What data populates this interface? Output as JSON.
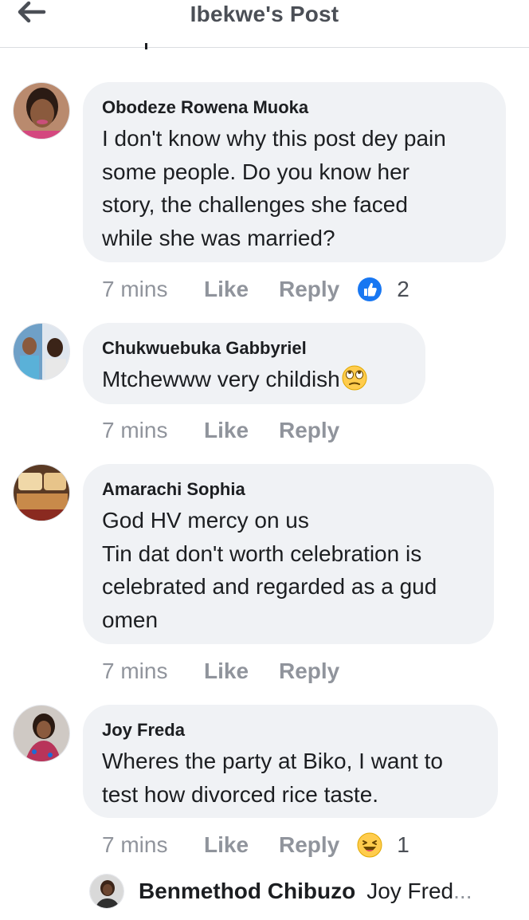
{
  "header": {
    "title": "Ibekwe's Post"
  },
  "comments": [
    {
      "author": "Obodeze Rowena Muoka",
      "lines": [
        "I don't know why this post dey pain",
        "some people. Do you know her",
        "story, the challenges she faced",
        "while she was married?"
      ],
      "time": "7 mins",
      "like_label": "Like",
      "reply_label": "Reply",
      "reaction": {
        "icon": "like-reaction-icon",
        "count": "2"
      }
    },
    {
      "author": "Chukwuebuka Gabbyriel",
      "lines": [
        "Mtchewww very childish"
      ],
      "inline_emoji": "eye-roll-emoji",
      "time": "7 mins",
      "like_label": "Like",
      "reply_label": "Reply"
    },
    {
      "author": "Amarachi Sophia",
      "lines": [
        "God HV mercy on us",
        "Tin dat don't worth celebration is",
        "celebrated and regarded as a gud",
        "omen"
      ],
      "time": "7 mins",
      "like_label": "Like",
      "reply_label": "Reply"
    },
    {
      "author": "Joy Freda",
      "lines": [
        "Wheres the party at Biko, I want to",
        "test how divorced rice taste."
      ],
      "time": "7 mins",
      "like_label": "Like",
      "reply_label": "Reply",
      "reaction": {
        "icon": "haha-reaction-icon",
        "count": "1"
      }
    }
  ],
  "reply_preview": {
    "author": "Benmethod Chibuzo",
    "text": "Joy Fred",
    "ellipsis": "..."
  },
  "colors": {
    "like_blue": "#1877f2",
    "meta_gray": "#90949c",
    "bubble_bg": "#f0f2f5"
  }
}
